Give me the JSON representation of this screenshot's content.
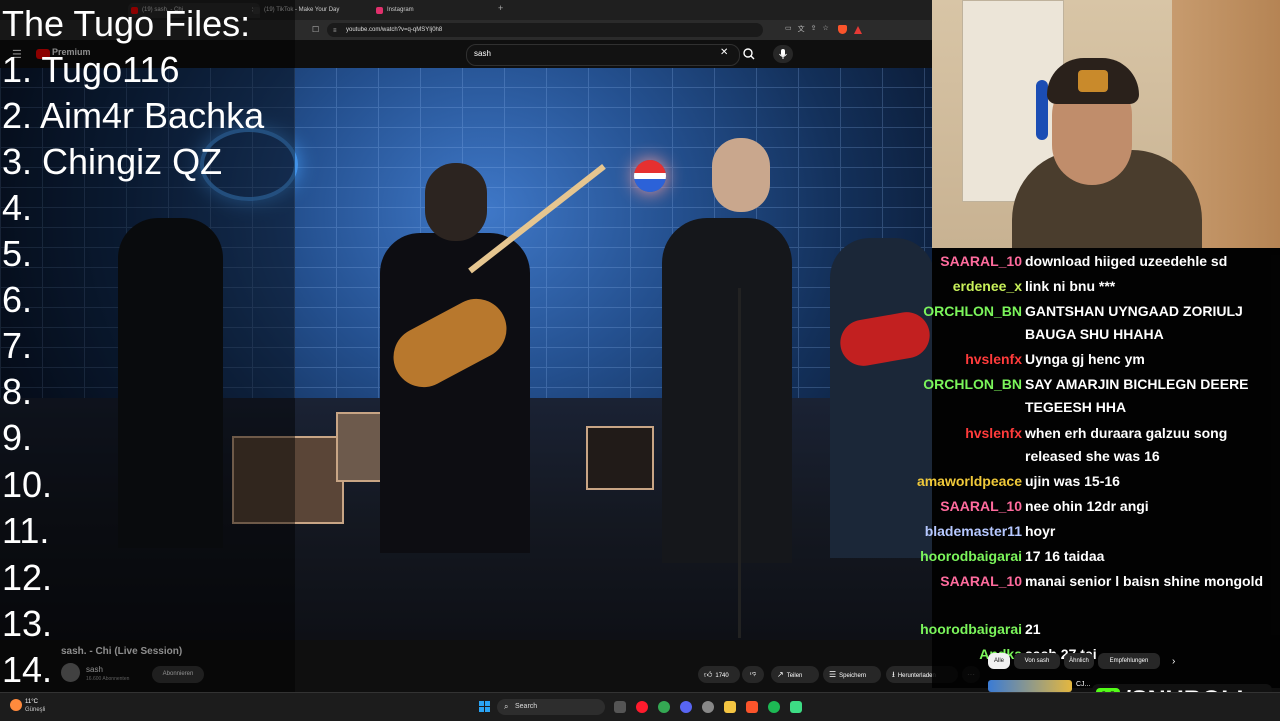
{
  "browser": {
    "tabs": [
      {
        "label": "(19) sash. - Chi",
        "color": "#ff0000"
      },
      {
        "label": "(19) TikTok - Make Your Day",
        "color": "#333333"
      },
      {
        "label": "Instagram",
        "color": "#e1306c"
      }
    ],
    "url": "youtube.com/watch?v=q-qMSYIj0h8"
  },
  "youtube": {
    "logo_text": "Premium",
    "search_query": "sash",
    "video_title": "sash. - Chi (Live Session)",
    "channel_name": "sash",
    "channel_subs": "16.600 Abonnenten",
    "subscribe_label": "Abonnieren",
    "like_count": "1740",
    "share_label": "Teilen",
    "save_label": "Speichern",
    "download_label": "Herunterladen",
    "more_label": "···",
    "chips": [
      "Alle",
      "Von sash",
      "Ähnlich",
      "Empfehlungen"
    ]
  },
  "tugo_list": {
    "title": "The Tugo Files:",
    "items": [
      "1. Tugo116",
      "2. Aim4r Bachka",
      "3. Chingiz QZ",
      "4.",
      "5.",
      "6.",
      "7.",
      "8.",
      "9.",
      "10.",
      "11.",
      "12.",
      "13.",
      "14."
    ]
  },
  "chat": [
    {
      "user": "SAARAL_10",
      "color": "#ff6b9d",
      "msg": "download hiiged uzeedehle sd"
    },
    {
      "user": "erdenee_x",
      "color": "#c8f05a",
      "msg": "link ni bnu ***"
    },
    {
      "user": "ORCHLON_BN",
      "color": "#7bf55b",
      "msg": "GANTSHAN UYNGAAD ZORIULJ BAUGA SHU HHAHA"
    },
    {
      "user": "hvslenfx",
      "color": "#ff3b3b",
      "msg": "Uynga gj henc ym"
    },
    {
      "user": "ORCHLON_BN",
      "color": "#7bf55b",
      "msg": "SAY AMARJIN BICHLEGN DEERE TEGEESH HHA"
    },
    {
      "user": "hvslenfx",
      "color": "#ff3b3b",
      "msg": "when erh duraara galzuu song released she was 16"
    },
    {
      "user": "amaworldpeace",
      "color": "#f0c93a",
      "msg": "ujin was 15-16"
    },
    {
      "user": "SAARAL_10",
      "color": "#ff6b9d",
      "msg": "nee ohin 12dr angi"
    },
    {
      "user": "blademaster11",
      "color": "#b6c8ff",
      "msg": "hoyr"
    },
    {
      "user": "hoorodbaigarai",
      "color": "#7bf55b",
      "msg": "17 16 taidaa"
    },
    {
      "user": "SAARAL_10",
      "color": "#ff6b9d",
      "msg": "manai senior l baisn shine mongold"
    },
    {
      "user": "hoorodbaigarai",
      "color": "#7bf55b",
      "msg": "21"
    },
    {
      "user": "Andka",
      "color": "#7bf55b",
      "msg": "sash 27 tei"
    }
  ],
  "watermark": {
    "text": "/SNUBOLI",
    "icon": "K"
  },
  "up_next": {
    "text": "CJ..."
  },
  "taskbar": {
    "weather_temp": "11°C",
    "weather_desc": "Güneşli",
    "search_label": "Search",
    "apps": [
      {
        "name": "file-explorer-icon",
        "color": "#555555"
      },
      {
        "name": "opera-icon",
        "color": "#ff1b2d"
      },
      {
        "name": "chrome-icon",
        "color": "#34a853"
      },
      {
        "name": "discord-icon",
        "color": "#5865f2"
      },
      {
        "name": "settings-icon",
        "color": "#888888"
      },
      {
        "name": "folder-icon",
        "color": "#f4c542"
      },
      {
        "name": "brave-icon",
        "color": "#fb542b"
      },
      {
        "name": "spotify-icon",
        "color": "#1db954"
      },
      {
        "name": "terminal-icon",
        "color": "#3ddc84"
      }
    ]
  }
}
